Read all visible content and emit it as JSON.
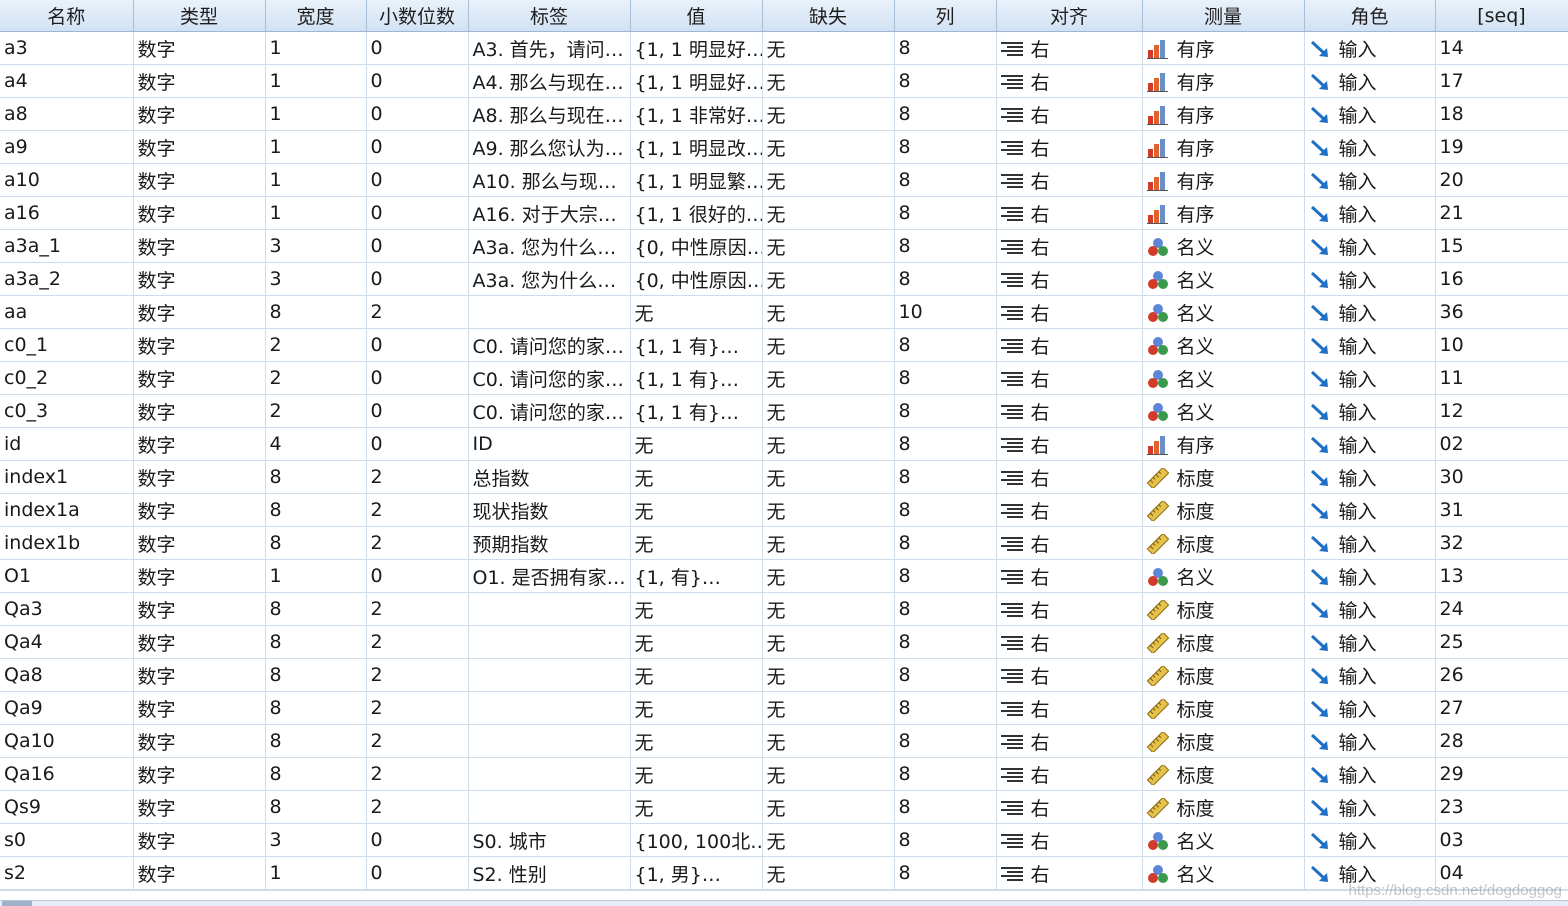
{
  "columns": [
    "名称",
    "类型",
    "宽度",
    "小数位数",
    "标签",
    "值",
    "缺失",
    "列",
    "对齐",
    "测量",
    "角色",
    "[seq]"
  ],
  "rows": [
    {
      "name": "a3",
      "type": "数字",
      "width": "1",
      "decimals": "0",
      "label": "A3. 首先，请问…",
      "values": "{1, 1 明显好…",
      "missing": "无",
      "columns": "8",
      "align": "右",
      "measure": "有序",
      "measure_icon": "ordinal-icon",
      "role": "输入",
      "seq": "14"
    },
    {
      "name": "a4",
      "type": "数字",
      "width": "1",
      "decimals": "0",
      "label": "A4. 那么与现在…",
      "values": "{1, 1 明显好…",
      "missing": "无",
      "columns": "8",
      "align": "右",
      "measure": "有序",
      "measure_icon": "ordinal-icon",
      "role": "输入",
      "seq": "17"
    },
    {
      "name": "a8",
      "type": "数字",
      "width": "1",
      "decimals": "0",
      "label": "A8. 那么与现在…",
      "values": "{1, 1 非常好…",
      "missing": "无",
      "columns": "8",
      "align": "右",
      "measure": "有序",
      "measure_icon": "ordinal-icon",
      "role": "输入",
      "seq": "18"
    },
    {
      "name": "a9",
      "type": "数字",
      "width": "1",
      "decimals": "0",
      "label": "A9. 那么您认为…",
      "values": "{1, 1 明显改…",
      "missing": "无",
      "columns": "8",
      "align": "右",
      "measure": "有序",
      "measure_icon": "ordinal-icon",
      "role": "输入",
      "seq": "19"
    },
    {
      "name": "a10",
      "type": "数字",
      "width": "1",
      "decimals": "0",
      "label": "A10. 那么与现…",
      "values": "{1, 1 明显繁…",
      "missing": "无",
      "columns": "8",
      "align": "右",
      "measure": "有序",
      "measure_icon": "ordinal-icon",
      "role": "输入",
      "seq": "20"
    },
    {
      "name": "a16",
      "type": "数字",
      "width": "1",
      "decimals": "0",
      "label": "A16. 对于大宗…",
      "values": "{1, 1 很好的…",
      "missing": "无",
      "columns": "8",
      "align": "右",
      "measure": "有序",
      "measure_icon": "ordinal-icon",
      "role": "输入",
      "seq": "21"
    },
    {
      "name": "a3a_1",
      "type": "数字",
      "width": "3",
      "decimals": "0",
      "label": "A3a. 您为什么…",
      "values": "{0, 中性原因…",
      "missing": "无",
      "columns": "8",
      "align": "右",
      "measure": "名义",
      "measure_icon": "nominal-icon",
      "role": "输入",
      "seq": "15"
    },
    {
      "name": "a3a_2",
      "type": "数字",
      "width": "3",
      "decimals": "0",
      "label": "A3a. 您为什么…",
      "values": "{0, 中性原因…",
      "missing": "无",
      "columns": "8",
      "align": "右",
      "measure": "名义",
      "measure_icon": "nominal-icon",
      "role": "输入",
      "seq": "16"
    },
    {
      "name": "aa",
      "type": "数字",
      "width": "8",
      "decimals": "2",
      "label": "",
      "values": "无",
      "missing": "无",
      "columns": "10",
      "align": "右",
      "measure": "名义",
      "measure_icon": "nominal-icon",
      "role": "输入",
      "seq": "36"
    },
    {
      "name": "c0_1",
      "type": "数字",
      "width": "2",
      "decimals": "0",
      "label": "C0. 请问您的家…",
      "values": "{1, 1 有}…",
      "missing": "无",
      "columns": "8",
      "align": "右",
      "measure": "名义",
      "measure_icon": "nominal-icon",
      "role": "输入",
      "seq": "10"
    },
    {
      "name": "c0_2",
      "type": "数字",
      "width": "2",
      "decimals": "0",
      "label": "C0. 请问您的家…",
      "values": "{1, 1 有}…",
      "missing": "无",
      "columns": "8",
      "align": "右",
      "measure": "名义",
      "measure_icon": "nominal-icon",
      "role": "输入",
      "seq": "11"
    },
    {
      "name": "c0_3",
      "type": "数字",
      "width": "2",
      "decimals": "0",
      "label": "C0. 请问您的家…",
      "values": "{1, 1 有}…",
      "missing": "无",
      "columns": "8",
      "align": "右",
      "measure": "名义",
      "measure_icon": "nominal-icon",
      "role": "输入",
      "seq": "12"
    },
    {
      "name": "id",
      "type": "数字",
      "width": "4",
      "decimals": "0",
      "label": "ID",
      "values": "无",
      "missing": "无",
      "columns": "8",
      "align": "右",
      "measure": "有序",
      "measure_icon": "ordinal-icon",
      "role": "输入",
      "seq": "02"
    },
    {
      "name": "index1",
      "type": "数字",
      "width": "8",
      "decimals": "2",
      "label": "总指数",
      "values": "无",
      "missing": "无",
      "columns": "8",
      "align": "右",
      "measure": "标度",
      "measure_icon": "scale-icon",
      "role": "输入",
      "seq": "30"
    },
    {
      "name": "index1a",
      "type": "数字",
      "width": "8",
      "decimals": "2",
      "label": "现状指数",
      "values": "无",
      "missing": "无",
      "columns": "8",
      "align": "右",
      "measure": "标度",
      "measure_icon": "scale-icon",
      "role": "输入",
      "seq": "31"
    },
    {
      "name": "index1b",
      "type": "数字",
      "width": "8",
      "decimals": "2",
      "label": "预期指数",
      "values": "无",
      "missing": "无",
      "columns": "8",
      "align": "右",
      "measure": "标度",
      "measure_icon": "scale-icon",
      "role": "输入",
      "seq": "32"
    },
    {
      "name": "O1",
      "type": "数字",
      "width": "1",
      "decimals": "0",
      "label": "O1. 是否拥有家…",
      "values": "{1, 有}…",
      "missing": "无",
      "columns": "8",
      "align": "右",
      "measure": "名义",
      "measure_icon": "nominal-icon",
      "role": "输入",
      "seq": "13"
    },
    {
      "name": "Qa3",
      "type": "数字",
      "width": "8",
      "decimals": "2",
      "label": "",
      "values": "无",
      "missing": "无",
      "columns": "8",
      "align": "右",
      "measure": "标度",
      "measure_icon": "scale-icon",
      "role": "输入",
      "seq": "24"
    },
    {
      "name": "Qa4",
      "type": "数字",
      "width": "8",
      "decimals": "2",
      "label": "",
      "values": "无",
      "missing": "无",
      "columns": "8",
      "align": "右",
      "measure": "标度",
      "measure_icon": "scale-icon",
      "role": "输入",
      "seq": "25"
    },
    {
      "name": "Qa8",
      "type": "数字",
      "width": "8",
      "decimals": "2",
      "label": "",
      "values": "无",
      "missing": "无",
      "columns": "8",
      "align": "右",
      "measure": "标度",
      "measure_icon": "scale-icon",
      "role": "输入",
      "seq": "26"
    },
    {
      "name": "Qa9",
      "type": "数字",
      "width": "8",
      "decimals": "2",
      "label": "",
      "values": "无",
      "missing": "无",
      "columns": "8",
      "align": "右",
      "measure": "标度",
      "measure_icon": "scale-icon",
      "role": "输入",
      "seq": "27"
    },
    {
      "name": "Qa10",
      "type": "数字",
      "width": "8",
      "decimals": "2",
      "label": "",
      "values": "无",
      "missing": "无",
      "columns": "8",
      "align": "右",
      "measure": "标度",
      "measure_icon": "scale-icon",
      "role": "输入",
      "seq": "28"
    },
    {
      "name": "Qa16",
      "type": "数字",
      "width": "8",
      "decimals": "2",
      "label": "",
      "values": "无",
      "missing": "无",
      "columns": "8",
      "align": "右",
      "measure": "标度",
      "measure_icon": "scale-icon",
      "role": "输入",
      "seq": "29"
    },
    {
      "name": "Qs9",
      "type": "数字",
      "width": "8",
      "decimals": "2",
      "label": "",
      "values": "无",
      "missing": "无",
      "columns": "8",
      "align": "右",
      "measure": "标度",
      "measure_icon": "scale-icon",
      "role": "输入",
      "seq": "23"
    },
    {
      "name": "s0",
      "type": "数字",
      "width": "3",
      "decimals": "0",
      "label": "S0. 城市",
      "values": "{100, 100北…",
      "missing": "无",
      "columns": "8",
      "align": "右",
      "measure": "名义",
      "measure_icon": "nominal-icon",
      "role": "输入",
      "seq": "03"
    },
    {
      "name": "s2",
      "type": "数字",
      "width": "1",
      "decimals": "0",
      "label": "S2. 性别",
      "values": "{1, 男}…",
      "missing": "无",
      "columns": "8",
      "align": "右",
      "measure": "名义",
      "measure_icon": "nominal-icon",
      "role": "输入",
      "seq": "04"
    }
  ],
  "role_icon": "arrow-input-icon",
  "align_icon": "align-right-icon",
  "watermark": "https://blog.csdn.net/dogdoggog",
  "colors": {
    "header_bg": "#d9e6f5",
    "grid": "#cfdcea",
    "role_arrow": "#1f6fc5"
  }
}
